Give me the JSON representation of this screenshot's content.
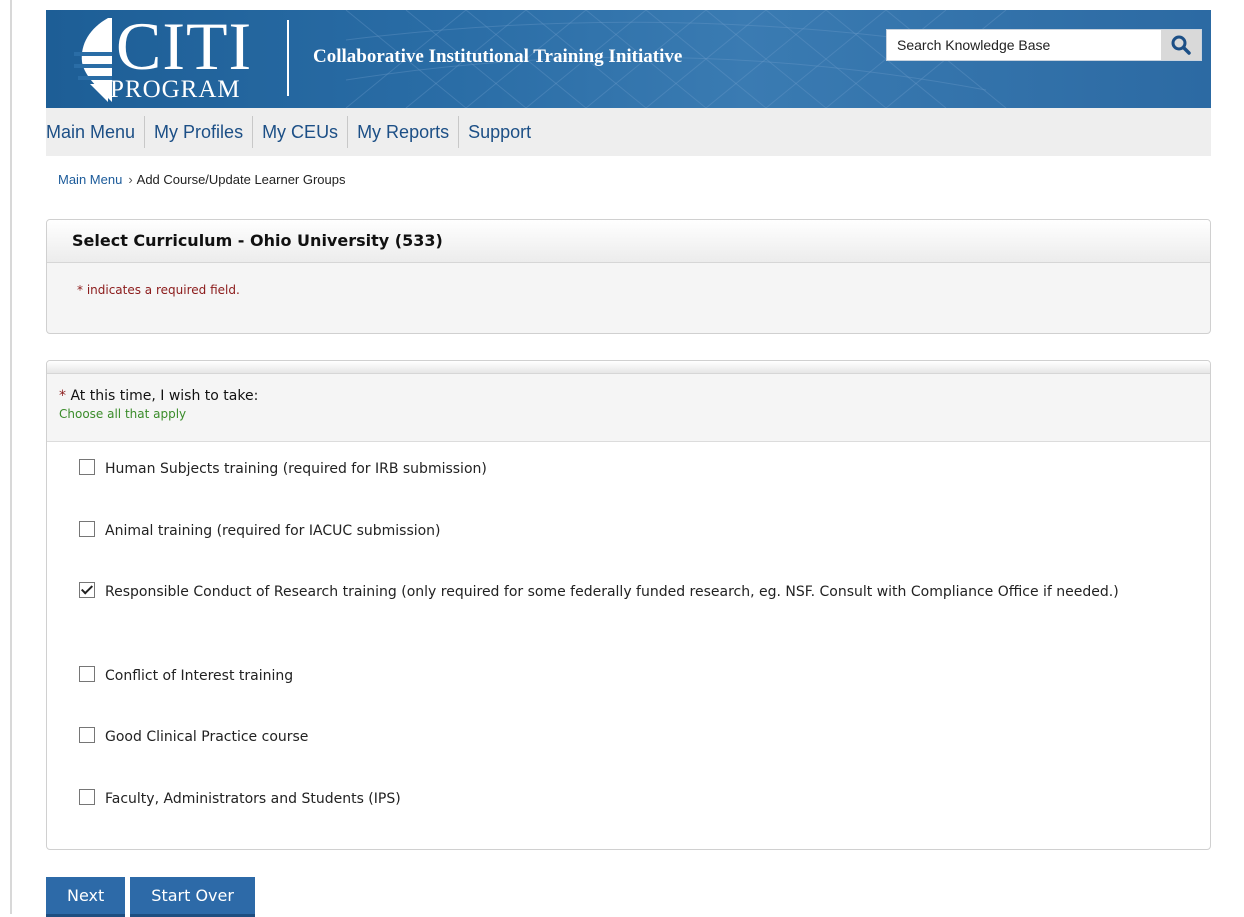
{
  "header": {
    "logo_citi": "CITI",
    "logo_program": "PROGRAM",
    "tagline": "Collaborative Institutional Training Initiative",
    "search_placeholder": "Search Knowledge Base"
  },
  "nav": {
    "items": [
      "Main Menu",
      "My Profiles",
      "My CEUs",
      "My Reports",
      "Support"
    ]
  },
  "breadcrumb": {
    "home": "Main Menu",
    "separator": "›",
    "current": "Add Course/Update Learner Groups"
  },
  "curriculum_panel": {
    "title": "Select Curriculum - Ohio University (533)",
    "required_note": "* indicates a required field."
  },
  "question": {
    "required_marker": "*",
    "label": "At this time, I wish to take:",
    "hint": "Choose all that apply",
    "options": [
      {
        "label": "Human Subjects training (required for IRB submission)",
        "checked": false
      },
      {
        "label": "Animal training (required for IACUC submission)",
        "checked": false
      },
      {
        "label": "Responsible Conduct of Research training (only required for some federally funded research, eg. NSF. Consult with Compliance Office if needed.)",
        "checked": true
      },
      {
        "label": "Conflict of Interest training",
        "checked": false
      },
      {
        "label": "Good Clinical Practice course",
        "checked": false
      },
      {
        "label": "Faculty, Administrators and Students (IPS)",
        "checked": false
      }
    ]
  },
  "buttons": {
    "next": "Next",
    "start_over": "Start Over"
  },
  "colors": {
    "banner": "#2a6da6",
    "nav_link": "#1c4f86",
    "button": "#2d6aa8",
    "required": "#8b1a1a",
    "hint": "#3a8c2a"
  }
}
